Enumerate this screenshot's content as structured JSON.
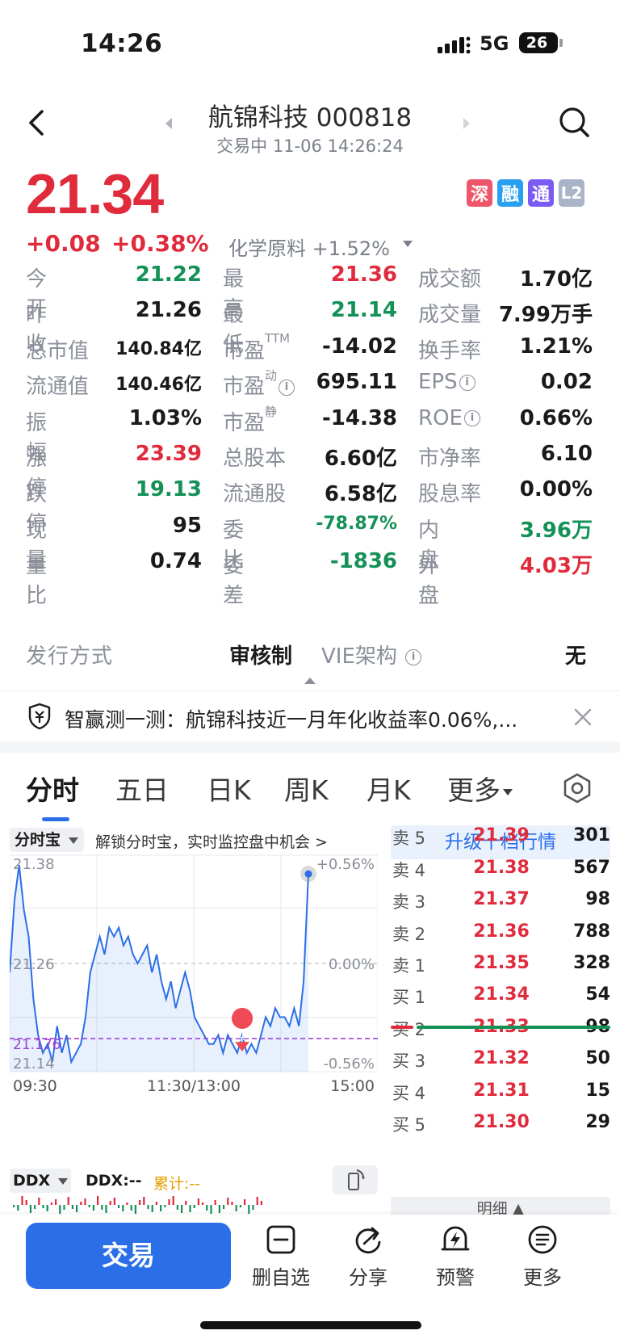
{
  "status": {
    "time": "14:26",
    "network": "5G",
    "battery": "26"
  },
  "header": {
    "title": "航锦科技 000818",
    "subtitle": "交易中 11-06 14:26:24"
  },
  "quote": {
    "price": "21.34",
    "change": "+0.08",
    "change_pct": "+0.38%",
    "sector": "化学原料 +1.52%",
    "badges": [
      {
        "label": "深",
        "color": "#f0566b"
      },
      {
        "label": "融",
        "color": "#2aa0f0"
      },
      {
        "label": "通",
        "color": "#7a5cf5"
      },
      {
        "label": "L2",
        "color": "#a9b4c8"
      }
    ]
  },
  "stats": [
    [
      {
        "l": "今开",
        "v": "21.22",
        "c": "green"
      },
      {
        "l": "最高",
        "v": "21.36",
        "c": "red"
      },
      {
        "l": "成交额",
        "v": "1.70亿",
        "c": "dark"
      }
    ],
    [
      {
        "l": "昨收",
        "v": "21.26",
        "c": "dark"
      },
      {
        "l": "最低",
        "v": "21.14",
        "c": "green"
      },
      {
        "l": "成交量",
        "v": "7.99万手",
        "c": "dark"
      }
    ],
    [
      {
        "l": "总市值",
        "v": "140.84亿",
        "c": "dark"
      },
      {
        "l": "市盈",
        "sup": "TTM",
        "v": "-14.02",
        "c": "dark"
      },
      {
        "l": "换手率",
        "v": "1.21%",
        "c": "dark"
      }
    ],
    [
      {
        "l": "流通值",
        "v": "140.46亿",
        "c": "dark"
      },
      {
        "l": "市盈",
        "sup": "动",
        "info": true,
        "v": "695.11",
        "c": "dark"
      },
      {
        "l": "EPS",
        "info": true,
        "v": "0.02",
        "c": "dark"
      }
    ],
    [
      {
        "l": "振幅",
        "v": "1.03%",
        "c": "dark"
      },
      {
        "l": "市盈",
        "sup": "静",
        "v": "-14.38",
        "c": "dark"
      },
      {
        "l": "ROE",
        "info": true,
        "v": "0.66%",
        "c": "dark"
      }
    ],
    [
      {
        "l": "涨停",
        "v": "23.39",
        "c": "red"
      },
      {
        "l": "总股本",
        "v": "6.60亿",
        "c": "dark"
      },
      {
        "l": "市净率",
        "v": "6.10",
        "c": "dark"
      }
    ],
    [
      {
        "l": "跌停",
        "v": "19.13",
        "c": "green"
      },
      {
        "l": "流通股",
        "v": "6.58亿",
        "c": "dark"
      },
      {
        "l": "股息率",
        "v": "0.00%",
        "c": "dark"
      }
    ],
    [
      {
        "l": "现量",
        "v": "95",
        "c": "dark"
      },
      {
        "l": "委比",
        "v": "-78.87%",
        "c": "green"
      },
      {
        "l": "内盘",
        "v": "3.96万",
        "c": "green"
      }
    ],
    [
      {
        "l": "量比",
        "v": "0.74",
        "c": "dark"
      },
      {
        "l": "委差",
        "v": "-1836",
        "c": "green"
      },
      {
        "l": "外盘",
        "v": "4.03万",
        "c": "red"
      }
    ]
  ],
  "issue": {
    "label": "发行方式",
    "value": "审核制",
    "vie_label": "VIE架构",
    "vie_value": "无"
  },
  "banner": {
    "text": "智赢测一测：航锦科技近一月年化收益率0.06%,..."
  },
  "tabs": [
    "分时",
    "五日",
    "日K",
    "周K",
    "月K",
    "更多"
  ],
  "chart": {
    "mode_label": "分时宝",
    "tip": "解锁分时宝，实时监控盘中机会 >",
    "y_top": "21.38",
    "y_mid": "21.26",
    "y_bottom": "21.14",
    "pct_top": "+0.56%",
    "pct_mid": "0.00%",
    "pct_bottom": "-0.56%",
    "avg_label": "21.176",
    "buy_marker": "买",
    "x_labels": [
      "09:30",
      "11:30/13:00",
      "15:00"
    ],
    "line_color": "#2b6fe8",
    "avg_color": "#9c3fd6"
  },
  "chart_data": {
    "type": "line",
    "title": "",
    "ylim": [
      21.14,
      21.38
    ],
    "prev_close": 21.26,
    "avg_price": 21.176,
    "x": [
      "09:30",
      "11:30/13:00",
      "15:00"
    ],
    "series": [
      {
        "values": [
          21.25,
          21.33,
          21.37,
          21.32,
          21.29,
          21.22,
          21.18,
          21.16,
          21.17,
          21.15,
          21.19,
          21.16,
          21.18,
          21.15,
          21.16,
          21.17,
          21.2,
          21.25,
          21.27,
          21.29,
          21.27,
          21.3,
          21.29,
          21.3,
          21.28,
          21.29,
          21.27,
          21.26,
          21.27,
          21.28,
          21.25,
          21.27,
          21.24,
          21.22,
          21.24,
          21.21,
          21.23,
          21.25,
          21.23,
          21.2,
          21.19,
          21.18,
          21.17,
          21.17,
          21.18,
          21.16,
          21.18,
          21.17,
          21.16,
          21.18,
          21.16,
          21.17,
          21.16,
          21.18,
          21.2,
          21.19,
          21.21,
          21.2,
          21.2,
          21.19,
          21.21,
          21.19,
          21.24,
          21.36
        ]
      }
    ]
  },
  "orderbook": {
    "upgrade_label": "升级十档行情",
    "sell": [
      {
        "l": "卖 5",
        "p": "21.39",
        "v": "301"
      },
      {
        "l": "卖 4",
        "p": "21.38",
        "v": "567"
      },
      {
        "l": "卖 3",
        "p": "21.37",
        "v": "98"
      },
      {
        "l": "卖 2",
        "p": "21.36",
        "v": "788"
      },
      {
        "l": "卖 1",
        "p": "21.35",
        "v": "328"
      }
    ],
    "buy": [
      {
        "l": "买 1",
        "p": "21.34",
        "v": "54"
      },
      {
        "l": "买 2",
        "p": "21.33",
        "v": "98"
      },
      {
        "l": "买 3",
        "p": "21.32",
        "v": "50"
      },
      {
        "l": "买 4",
        "p": "21.31",
        "v": "15"
      },
      {
        "l": "买 5",
        "p": "21.30",
        "v": "29"
      }
    ],
    "detail_label": "明细 ▲"
  },
  "ddx": {
    "selector": "DDX",
    "value": "DDX:--",
    "cumulative": "累计:--"
  },
  "bottom": {
    "trade": "交易",
    "actions": [
      {
        "label": "删自选",
        "icon": "minus-square-icon"
      },
      {
        "label": "分享",
        "icon": "share-icon"
      },
      {
        "label": "预警",
        "icon": "alert-bolt-icon"
      },
      {
        "label": "更多",
        "icon": "more-menu-icon"
      }
    ]
  }
}
